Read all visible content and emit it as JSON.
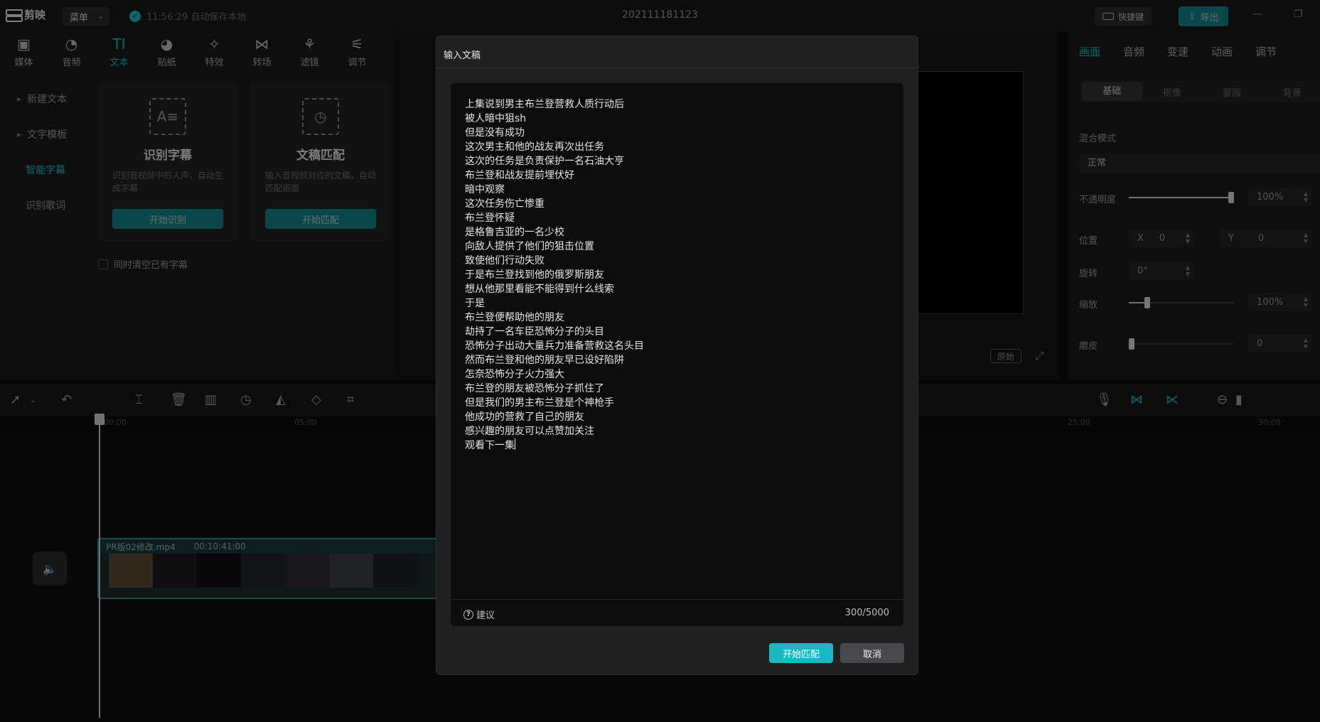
{
  "app": {
    "logo_text": "剪映",
    "menu_label": "菜单",
    "autosave_text": "11:56:29 自动保存本地",
    "project_title": "202111181123",
    "shortcut_label": "快捷键",
    "export_label": "导出"
  },
  "tools": [
    {
      "label": "媒体",
      "icon": "media-icon"
    },
    {
      "label": "音频",
      "icon": "audio-icon"
    },
    {
      "label": "文本",
      "icon": "text-icon"
    },
    {
      "label": "贴纸",
      "icon": "sticker-icon"
    },
    {
      "label": "特效",
      "icon": "effects-icon"
    },
    {
      "label": "转场",
      "icon": "transition-icon"
    },
    {
      "label": "滤镜",
      "icon": "filter-icon"
    },
    {
      "label": "调节",
      "icon": "adjust-icon"
    }
  ],
  "side_nav": [
    "新建文本",
    "文字模板",
    "智能字幕",
    "识别歌词"
  ],
  "cards": [
    {
      "title": "识别字幕",
      "desc": "识别音视频中的人声，自动生成字幕",
      "button": "开始识别"
    },
    {
      "title": "文稿匹配",
      "desc": "输入音视频对应的文稿，自动匹配画面",
      "button": "开始匹配"
    }
  ],
  "clear_option": "同时清空已有字幕",
  "preview": {
    "original_label": "原始"
  },
  "right_panel": {
    "tabs": [
      "画面",
      "音频",
      "变速",
      "动画",
      "调节"
    ],
    "subtabs": [
      "基础",
      "抠像",
      "蒙版",
      "背景"
    ],
    "blend_label": "混合模式",
    "blend_value": "正常",
    "opacity_label": "不透明度",
    "opacity_value": "100%",
    "opacity_level": 1.0,
    "position_label": "位置",
    "pos_x_label": "X",
    "pos_x": "0",
    "pos_y_label": "Y",
    "pos_y": "0",
    "rotate_label": "旋转",
    "rotate_value": "0°",
    "scale_label": "缩放",
    "scale_value": "100%",
    "blur_label": "磨皮",
    "blur_value": "0"
  },
  "timeline": {
    "ticks": [
      "00:00",
      "05:00",
      "25:00",
      "30:00"
    ],
    "clip_name": "PR版02修改.mp4",
    "clip_duration": "00:10:41:00"
  },
  "dialog": {
    "title": "输入文稿",
    "lines": [
      "上集说到男主布兰登营救人质行动后",
      "被人暗中狙sh",
      "但是没有成功",
      "这次男主和他的战友再次出任务",
      "这次的任务是负责保护一名石油大亨",
      "布兰登和战友提前埋伏好",
      "暗中观察",
      "这次任务伤亡惨重",
      "布兰登怀疑",
      "是格鲁吉亚的一名少校",
      "向敌人提供了他们的狙击位置",
      "致使他们行动失败",
      "于是布兰登找到他的俄罗斯朋友",
      "想从他那里看能不能得到什么线索",
      "于是",
      "布兰登便帮助他的朋友",
      "劫持了一名车臣恐怖分子的头目",
      "恐怖分子出动大量兵力准备营救这名头目",
      "然而布兰登和他的朋友早已设好陷阱",
      "怎奈恐怖分子火力强大",
      "布兰登的朋友被恐怖分子抓住了",
      "但是我们的男主布兰登是个神枪手",
      "他成功的营救了自己的朋友",
      "感兴趣的朋友可以点赞加关注",
      "观看下一集"
    ],
    "tip_label": "建议",
    "char_count": "300/5000",
    "start_button": "开始匹配",
    "cancel_button": "取消"
  }
}
